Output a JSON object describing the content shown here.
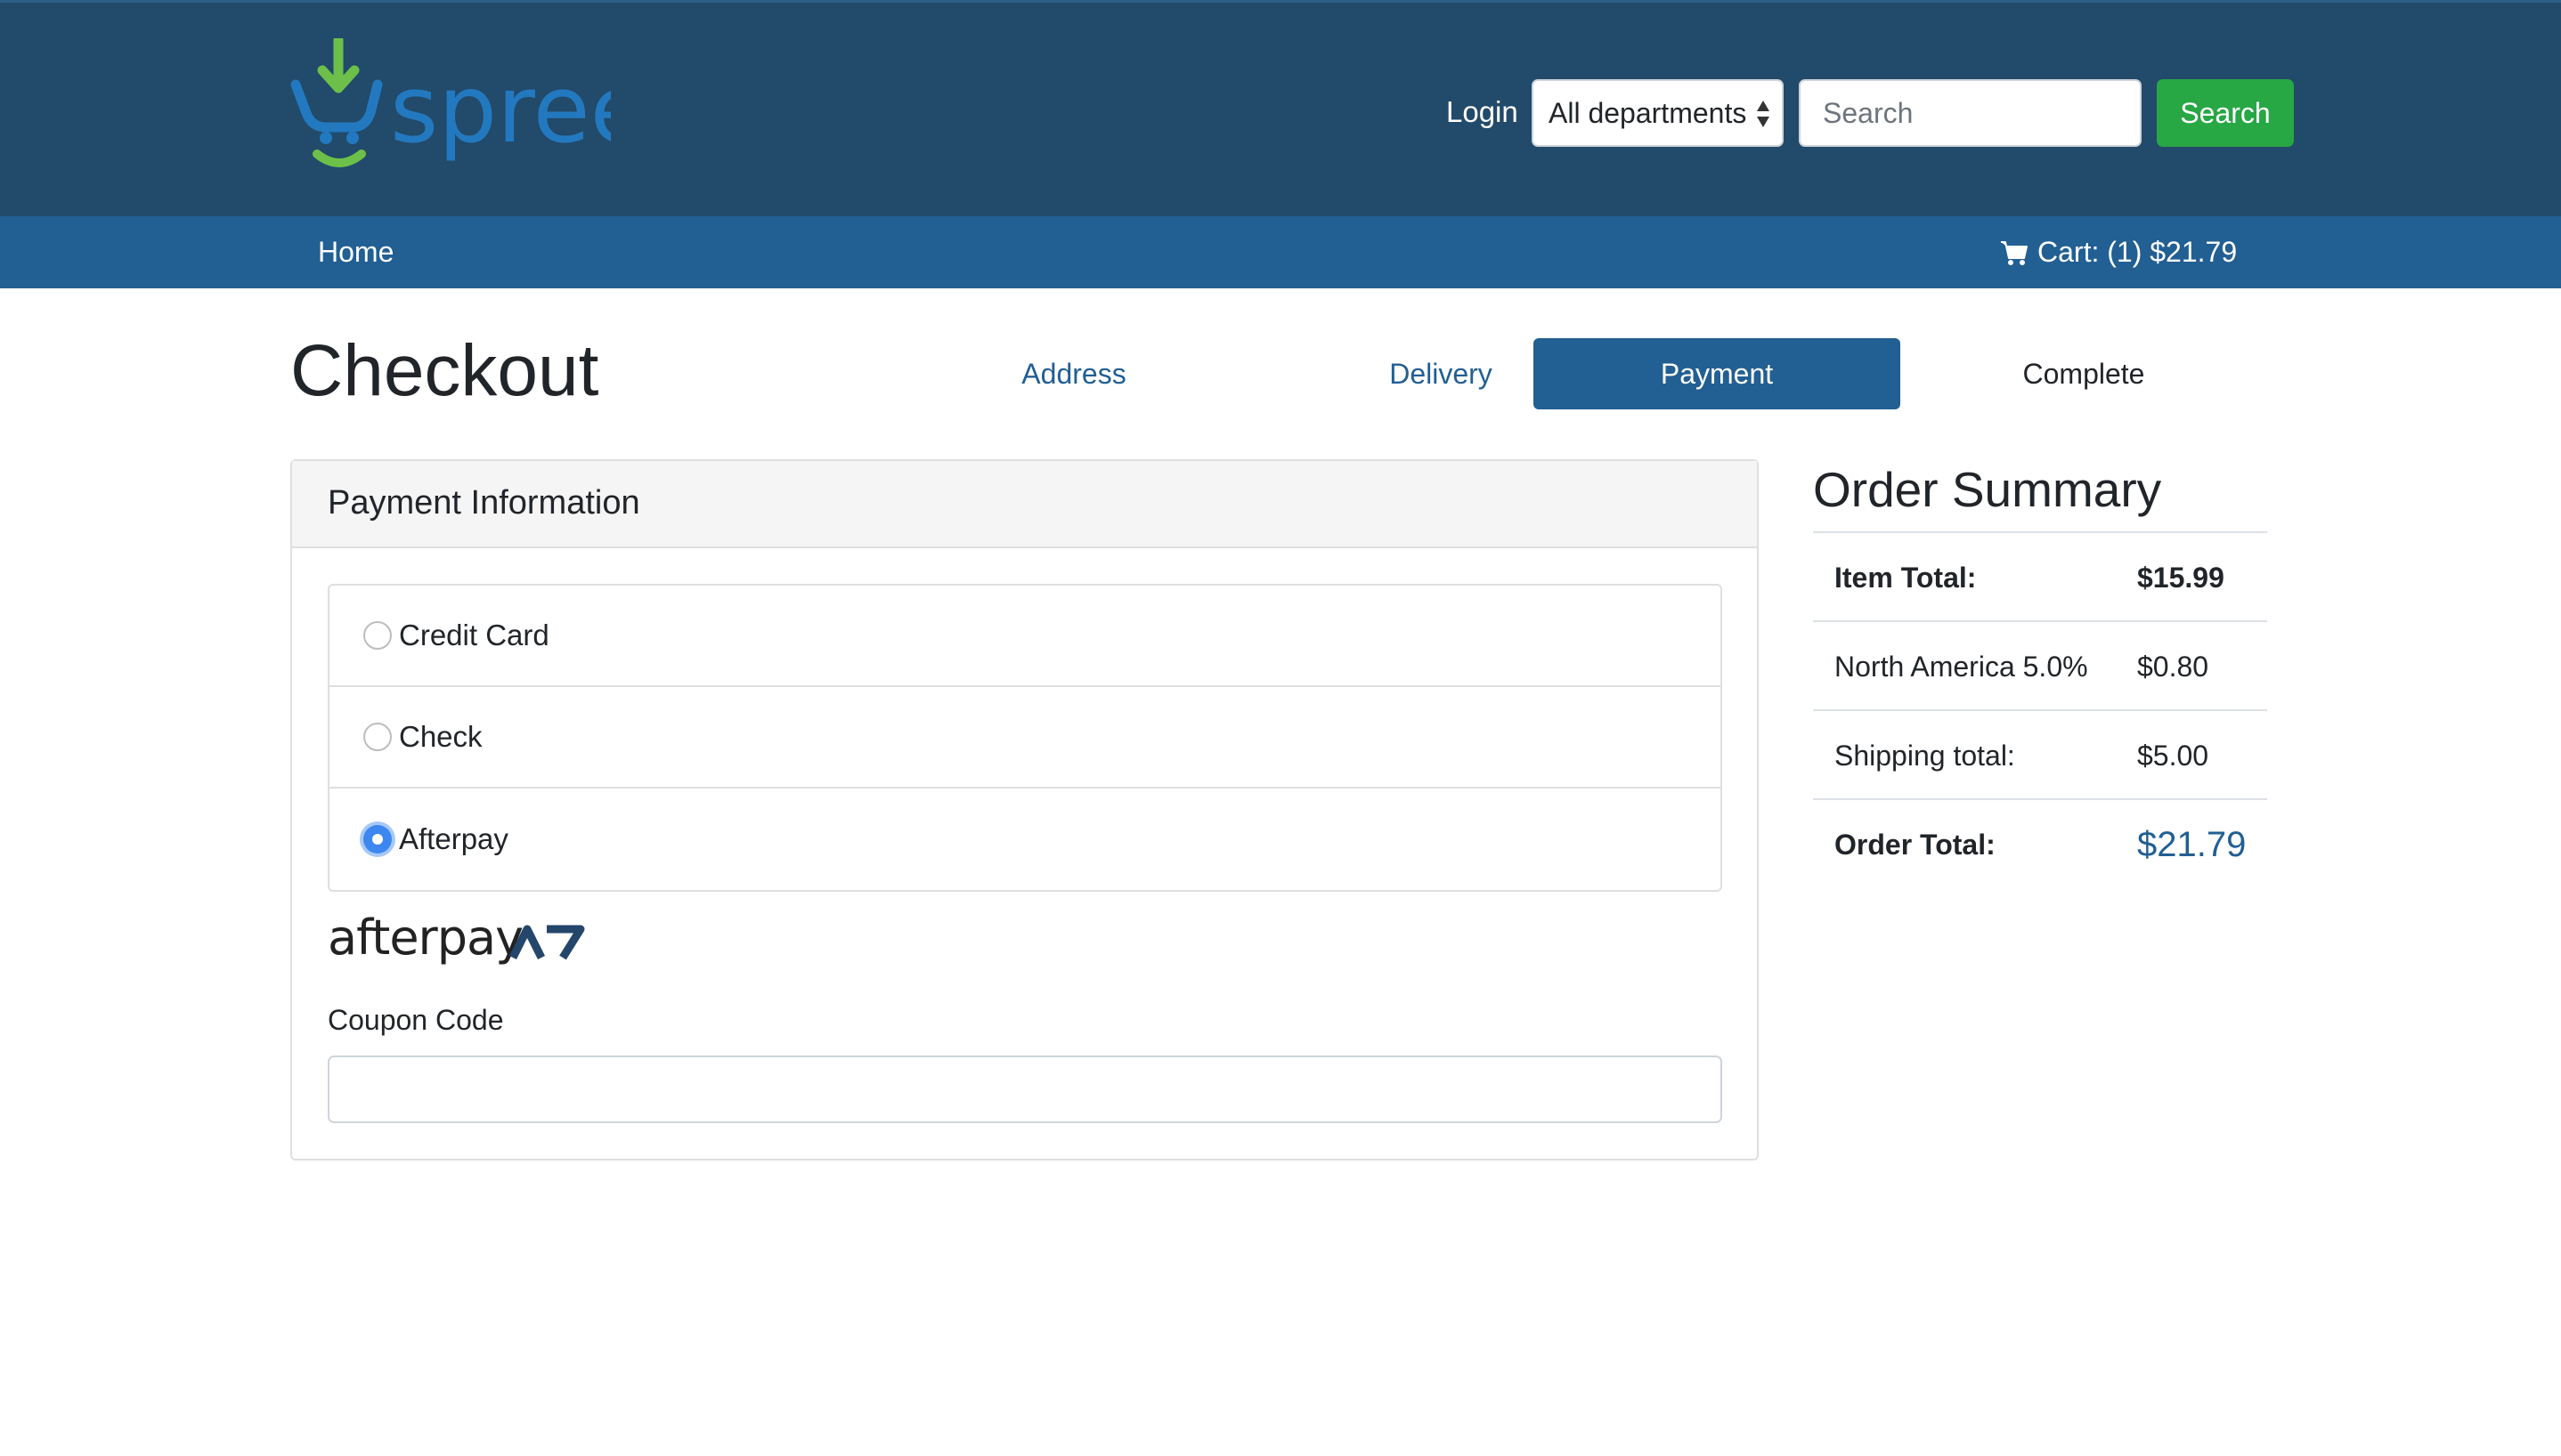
{
  "header": {
    "logo_text": "spree",
    "login_label": "Login",
    "department_select": "All departments",
    "search_placeholder": "Search",
    "search_button": "Search"
  },
  "nav": {
    "home_label": "Home",
    "cart_label": "Cart: (1) $21.79",
    "cart_icon": "cart-icon"
  },
  "checkout": {
    "title": "Checkout",
    "steps": [
      {
        "label": "Address",
        "state": "done"
      },
      {
        "label": "Delivery",
        "state": "done"
      },
      {
        "label": "Payment",
        "state": "active"
      },
      {
        "label": "Complete",
        "state": "todo"
      }
    ]
  },
  "payment": {
    "header": "Payment Information",
    "methods": [
      {
        "label": "Credit Card",
        "selected": false
      },
      {
        "label": "Check",
        "selected": false
      },
      {
        "label": "Afterpay",
        "selected": true
      }
    ],
    "afterpay_logo_text": "afterpay",
    "coupon_label": "Coupon Code",
    "coupon_value": ""
  },
  "summary": {
    "title": "Order Summary",
    "rows": [
      {
        "label": "Item Total:",
        "value": "$15.99"
      },
      {
        "label": "North America 5.0%",
        "value": "$0.80"
      },
      {
        "label": "Shipping total:",
        "value": "$5.00"
      },
      {
        "label": "Order Total:",
        "value": "$21.79"
      }
    ]
  },
  "colors": {
    "header_bg": "#224a6a",
    "nav_bg": "#225f93",
    "search_button": "#28a745",
    "radio_selected": "#3d87f0",
    "logo_green": "#6cc04a",
    "logo_blue": "#2379bf"
  }
}
